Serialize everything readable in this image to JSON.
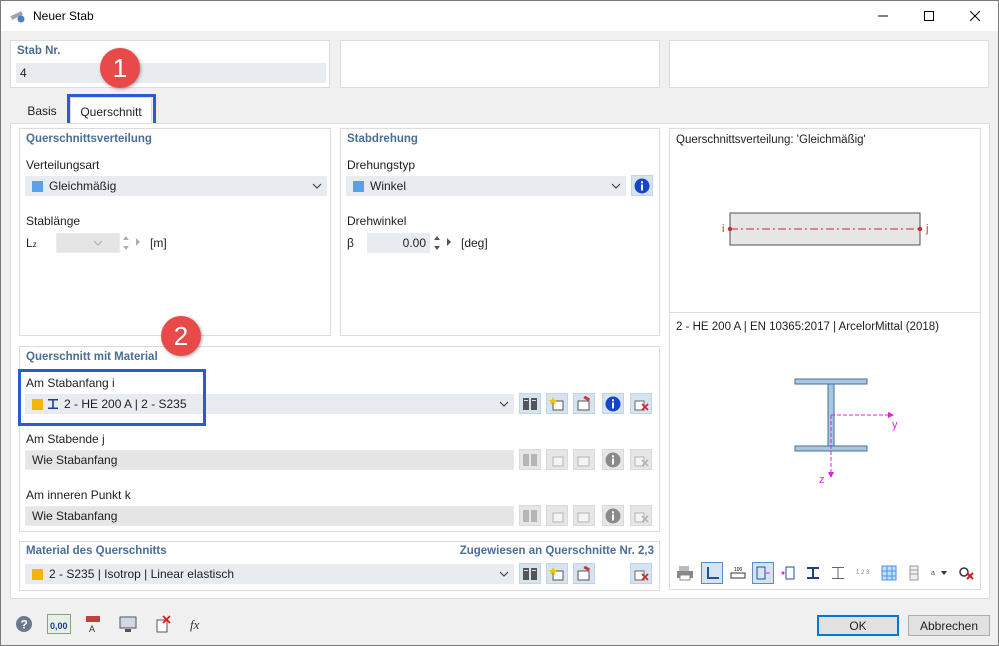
{
  "window": {
    "title": "Neuer Stab"
  },
  "stab": {
    "label": "Stab Nr.",
    "value": "4"
  },
  "tabs": [
    {
      "label": "Basis"
    },
    {
      "label": "Querschnitt"
    }
  ],
  "querschnittsverteilung": {
    "section_title": "Querschnittsverteilung",
    "verteilungsart_label": "Verteilungsart",
    "verteilungsart_value": "Gleichmäßig",
    "stablaenge_label": "Stablänge",
    "lz_symbol": "L",
    "lz_sub": "z",
    "lz_unit": "[m]"
  },
  "stabdrehung": {
    "section_title": "Stabdrehung",
    "drehungstyp_label": "Drehungstyp",
    "drehungstyp_value": "Winkel",
    "drehwinkel_label": "Drehwinkel",
    "beta_symbol": "β",
    "beta_value": "0.00",
    "beta_unit": "[deg]"
  },
  "querschnitt_material": {
    "section_title": "Querschnitt mit Material",
    "anfang_label": "Am Stabanfang i",
    "anfang_value": "2 - HE 200 A | 2 - S235",
    "ende_label": "Am Stabende j",
    "ende_value": "Wie Stabanfang",
    "punkt_label": "Am inneren Punkt k",
    "punkt_value": "Wie Stabanfang"
  },
  "material": {
    "section_title": "Material des Querschnitts",
    "assigned": "Zugewiesen an Querschnitte Nr. 2,3",
    "value": "2 - S235 | Isotrop | Linear elastisch"
  },
  "preview": {
    "top_title": "Querschnittsverteilung: 'Gleichmäßig'",
    "node_i": "i",
    "node_j": "j",
    "section_title": "2 - HE 200 A | EN 10365:2017 | ArcelorMittal (2018)",
    "axis_y": "y",
    "axis_z": "z"
  },
  "annotations": {
    "badge1": "1",
    "badge2": "2"
  },
  "buttons": {
    "ok": "OK",
    "cancel": "Abbrechen",
    "units_value": "0,00"
  },
  "colors": {
    "accent": "#4a6e96",
    "highlight": "#2a5bd7",
    "badge": "#e84a4a",
    "material_swatch": "#f2b705",
    "distribution_swatch": "#5aa0e6",
    "section_magenta": "#e020e0"
  }
}
